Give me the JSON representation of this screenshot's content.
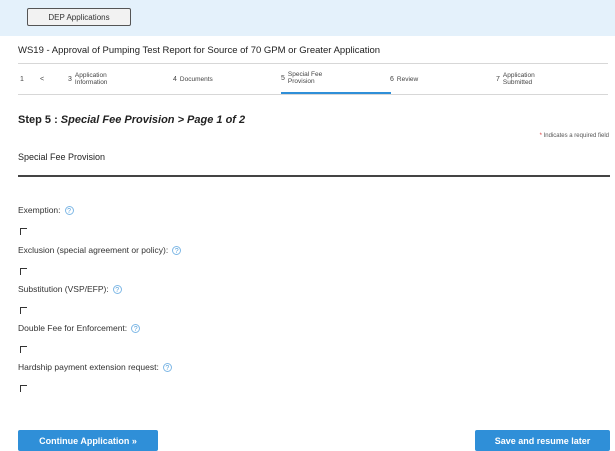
{
  "header": {
    "dep_button": "DEP Applications"
  },
  "application_title": "WS19 - Approval of Pumping Test Report for Source of 70 GPM or Greater Application",
  "steps": [
    {
      "num": "1",
      "label": ""
    },
    {
      "num": "<",
      "label": ""
    },
    {
      "num": "3",
      "label": "Application Information"
    },
    {
      "num": "4",
      "label": "Documents"
    },
    {
      "num": "5",
      "label": "Special Fee Provision"
    },
    {
      "num": "6",
      "label": "Review"
    },
    {
      "num": "7",
      "label": "Application Submitted"
    }
  ],
  "step_heading": {
    "prefix": "Step 5 :",
    "text": "Special Fee Provision > Page 1 of 2"
  },
  "required_note": {
    "asterisk": "*",
    "text": "Indicates a required field"
  },
  "section_title": "Special Fee Provision",
  "fields": [
    {
      "label": "Exemption:",
      "icon": "help-icon"
    },
    {
      "label": "Exclusion (special agreement or policy):",
      "icon": "help-icon"
    },
    {
      "label": "Substitution (VSP/EFP):",
      "icon": "help-icon"
    },
    {
      "label": "Double Fee for Enforcement:",
      "icon": "help-icon"
    },
    {
      "label": "Hardship payment extension request:",
      "icon": "help-icon"
    }
  ],
  "buttons": {
    "continue": "Continue Application »",
    "save": "Save and resume later"
  },
  "colors": {
    "accent": "#2f8fd8",
    "topbar": "#e4f1fb"
  }
}
